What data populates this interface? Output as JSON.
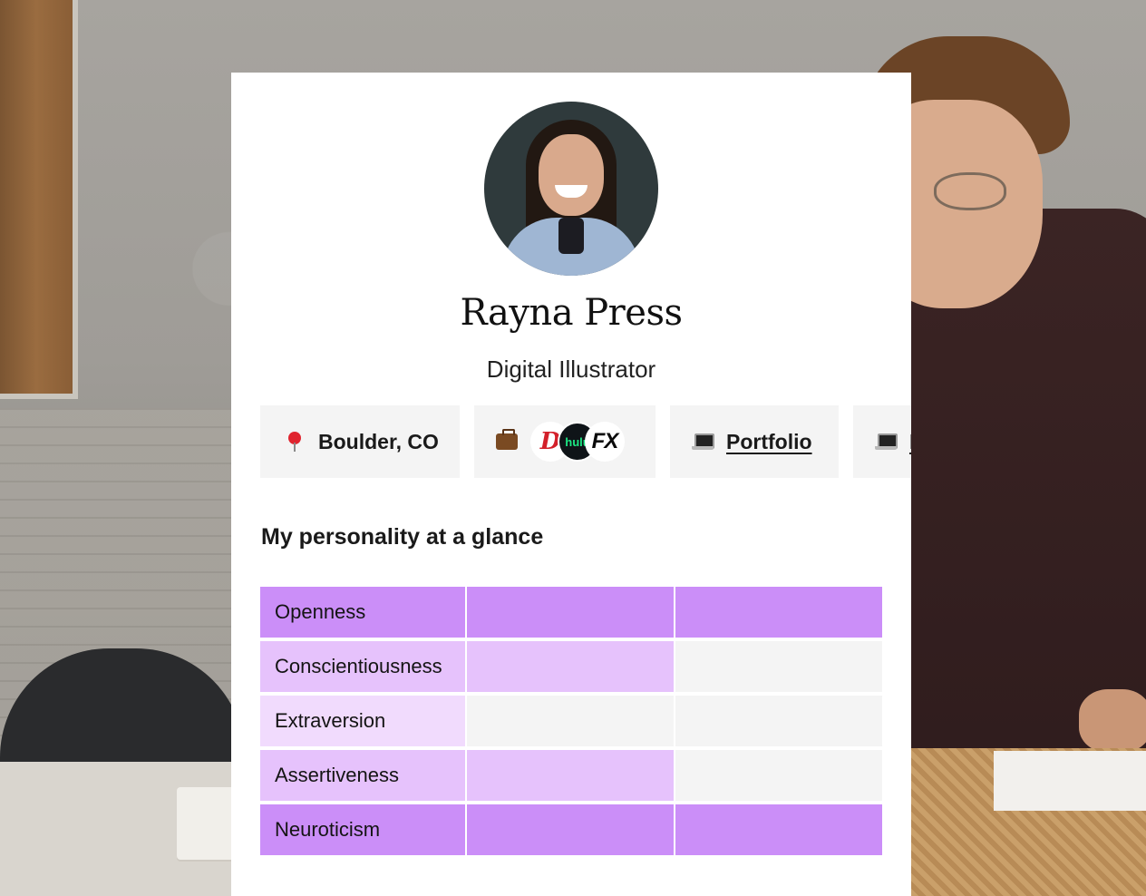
{
  "profile": {
    "name": "Rayna Press",
    "title": "Digital Illustrator"
  },
  "chips": {
    "location": {
      "icon": "pin-icon",
      "label": "Boulder, CO"
    },
    "work": {
      "icon": "briefcase-icon",
      "logos": [
        "disney-logo",
        "hulu-logo",
        "fx-logo"
      ],
      "hulu_text": "hulu",
      "fx_text": "FX",
      "disney_text": "D"
    },
    "portfolio": {
      "icon": "laptop-icon",
      "label": "Portfolio"
    },
    "extra": {
      "icon": "laptop-icon",
      "label": "L"
    }
  },
  "personality": {
    "heading": "My personality at a glance",
    "traits": [
      {
        "label": "Openness",
        "level": 3
      },
      {
        "label": "Conscientiousness",
        "level": 2
      },
      {
        "label": "Extraversion",
        "level": 1
      },
      {
        "label": "Assertiveness",
        "level": 2
      },
      {
        "label": "Neuroticism",
        "level": 3
      }
    ]
  },
  "colors": {
    "level_strong": "#cb8ef8",
    "level_medium": "#e6c2fc",
    "level_light": "#f1dbfd",
    "empty": "#f4f4f4"
  }
}
